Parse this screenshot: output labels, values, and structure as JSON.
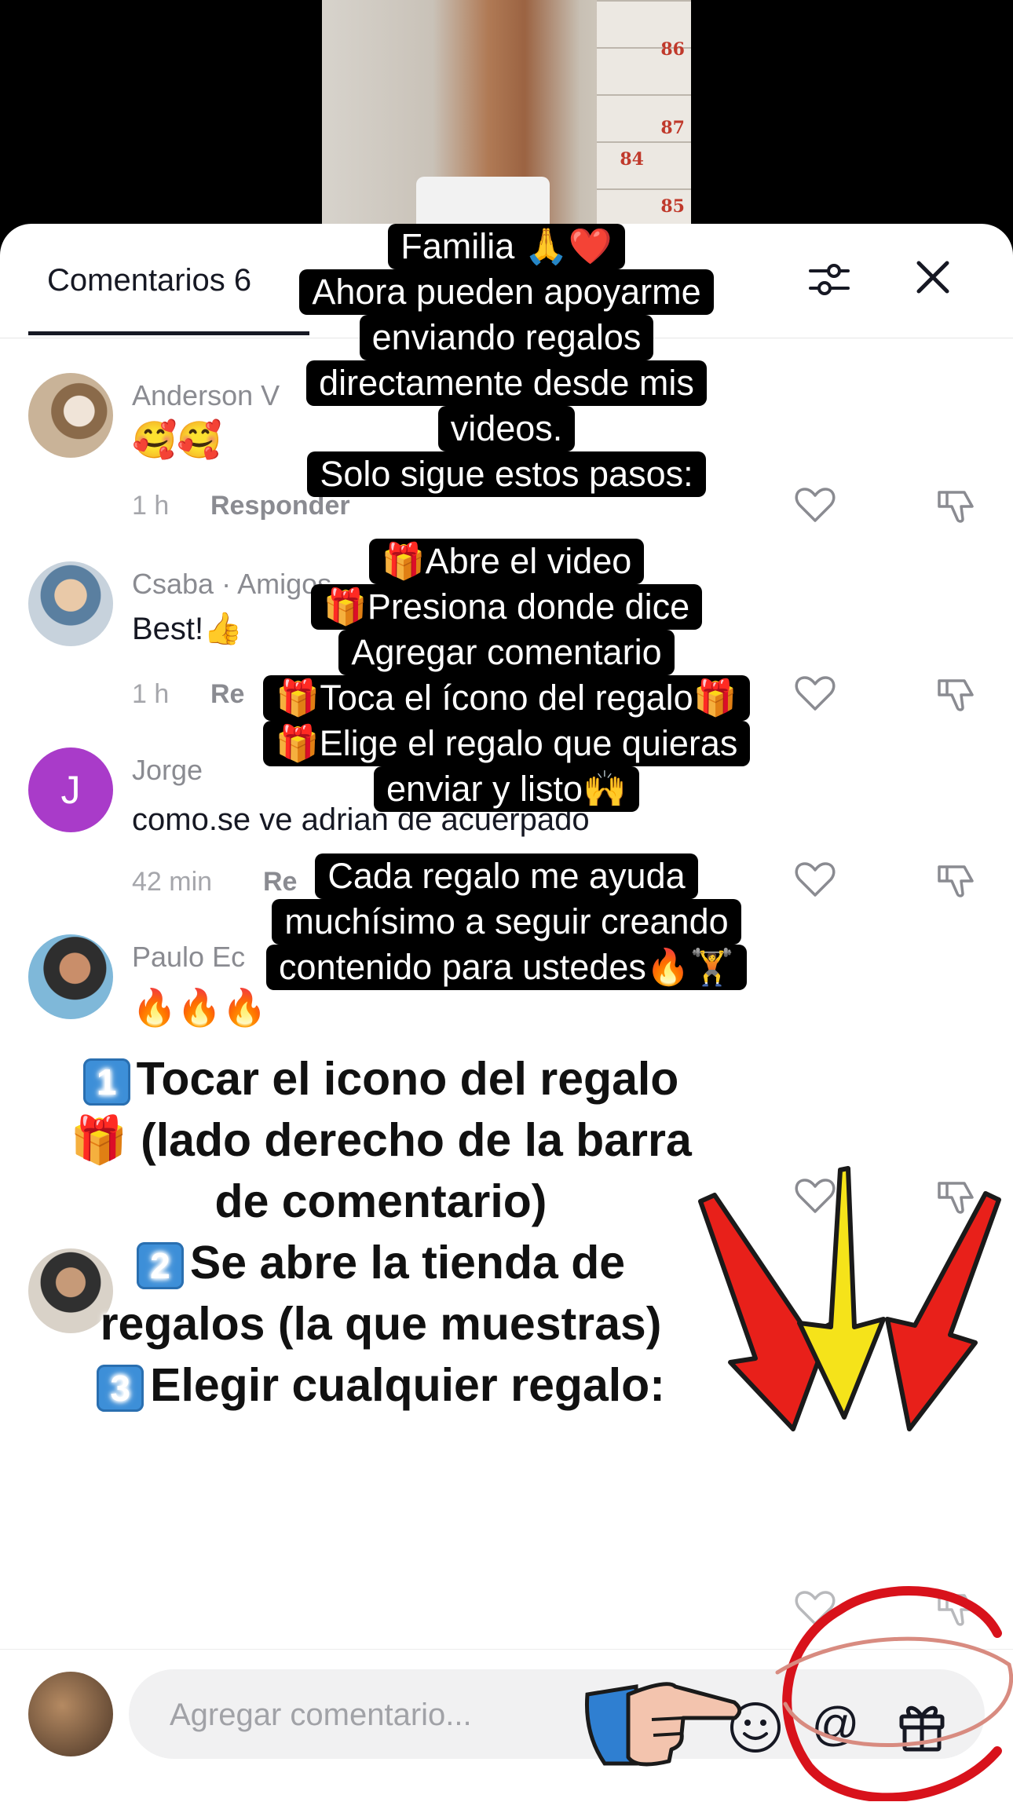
{
  "header": {
    "tab_title": "Comentarios 6"
  },
  "comments": [
    {
      "username": "Anderson V",
      "text": "🥰🥰",
      "time": "1 h",
      "reply": "Responder"
    },
    {
      "username": "Csaba · Amigos",
      "text": "Best!👍",
      "time": "1 h",
      "reply": "Re"
    },
    {
      "username": "Jorge",
      "avatar_letter": "J",
      "text": "como.se ve adrian de acuerpado",
      "time": "42 min",
      "reply": "Re"
    },
    {
      "username": "Paulo Ec",
      "text": "🔥🔥🔥"
    }
  ],
  "caption": [
    "Familia 🙏❤️",
    "Ahora pueden apoyarme",
    "enviando regalos",
    "directamente desde mis",
    "videos.",
    "Solo sigue estos pasos:",
    "🎁Abre el video",
    "🎁Presiona donde dice",
    "Agregar comentario",
    "🎁Toca el ícono del regalo🎁",
    "🎁Elige el regalo que quieras",
    "enviar y listo🙌",
    "Cada regalo me ayuda",
    "muchísimo a seguir creando",
    "contenido para ustedes🔥🏋️"
  ],
  "steps": {
    "step1_num": "1",
    "step1_line1": "Tocar el icono del regalo",
    "step1_line2": "🎁 (lado derecho de la barra",
    "step1_line3": "de comentario)",
    "step2_num": "2",
    "step2_line1": "Se abre la tienda de",
    "step2_line2": "regalos (la que muestras)",
    "step3_num": "3",
    "step3_line1": "Elegir cualquier regalo:"
  },
  "composer": {
    "placeholder": "Agregar comentario...",
    "at_label": "@"
  },
  "video": {
    "locker_numbers": [
      "86",
      "87",
      "84",
      "85"
    ]
  },
  "colors": {
    "arrow_red": "#e8201a",
    "arrow_yellow": "#f5e31a",
    "circle_red": "#d8121b",
    "badge_blue": "#3d8fd8",
    "jorge_avatar": "#a93bc9"
  }
}
